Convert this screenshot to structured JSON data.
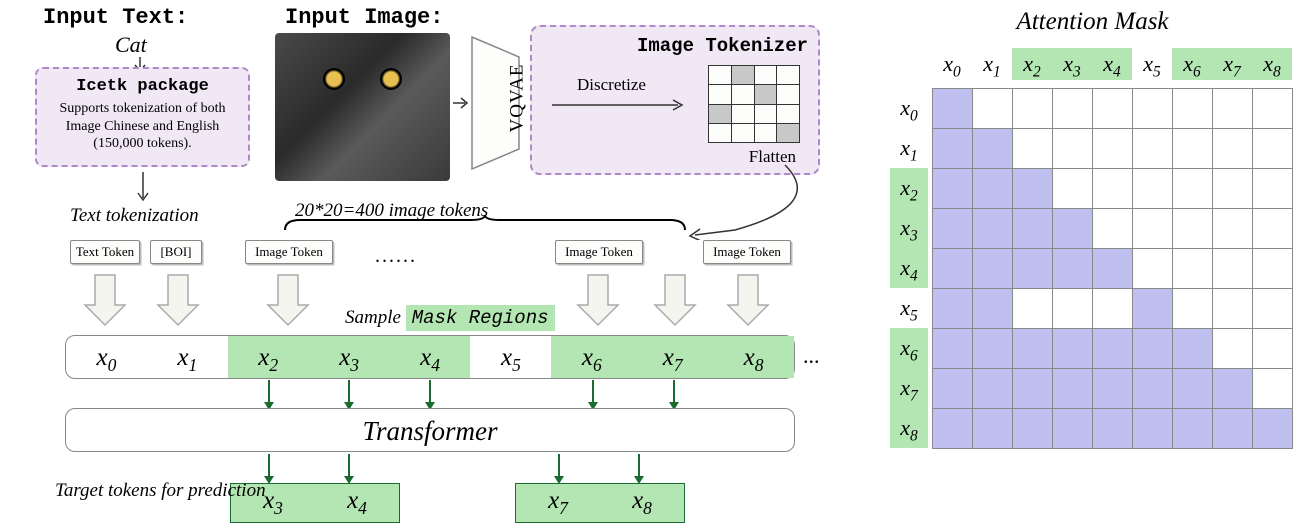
{
  "labels": {
    "input_text": "Input Text:",
    "cat": "Cat",
    "input_image": "Input Image:",
    "icetk_title": "Icetk package",
    "icetk_desc": "Supports tokenization of both Image Chinese and English (150,000 tokens).",
    "vqvae": "VQVAE",
    "tokenizer_title": "Image Tokenizer",
    "discretize": "Discretize",
    "flatten": "Flatten",
    "text_tokenization": "Text tokenization",
    "tokens_count": "20*20=400 image tokens",
    "text_token": "Text Token",
    "boi": "[BOI]",
    "image_token": "Image Token",
    "dots": "......",
    "sample": "Sample",
    "mask_regions": "Mask Regions",
    "transformer": "Transformer",
    "target": "Target tokens for prediction",
    "attn_title": "Attention Mask",
    "strip_dots": "..."
  },
  "tokens": [
    "x₀",
    "x₁",
    "x₂",
    "x₃",
    "x₄",
    "x₅",
    "x₆",
    "x₇",
    "x₈"
  ],
  "masked_tokens": [
    2,
    3,
    4,
    6,
    7,
    8
  ],
  "output_tokens_1": [
    "x₃",
    "x₄"
  ],
  "output_tokens_2": [
    "x₇",
    "x₈"
  ],
  "attention_mask": {
    "masked_cols": [
      2,
      3,
      4,
      6,
      7,
      8
    ],
    "masked_rows": [
      2,
      3,
      4,
      6,
      7,
      8
    ],
    "grid": [
      [
        1,
        0,
        0,
        0,
        0,
        0,
        0,
        0,
        0
      ],
      [
        1,
        1,
        0,
        0,
        0,
        0,
        0,
        0,
        0
      ],
      [
        1,
        1,
        1,
        0,
        0,
        0,
        0,
        0,
        0
      ],
      [
        1,
        1,
        1,
        1,
        0,
        0,
        0,
        0,
        0
      ],
      [
        1,
        1,
        1,
        1,
        1,
        0,
        0,
        0,
        0
      ],
      [
        1,
        1,
        0,
        0,
        0,
        1,
        0,
        0,
        0
      ],
      [
        1,
        1,
        1,
        1,
        1,
        1,
        1,
        0,
        0
      ],
      [
        1,
        1,
        1,
        1,
        1,
        1,
        1,
        1,
        0
      ],
      [
        1,
        1,
        1,
        1,
        1,
        1,
        1,
        1,
        1
      ]
    ]
  },
  "tokenizer_grid_shaded": [
    [
      0,
      1
    ],
    [
      1,
      2
    ],
    [
      2,
      0
    ],
    [
      3,
      3
    ]
  ],
  "chart_data": {
    "type": "diagram",
    "title": "Transformer architecture with text+image tokens and attention mask",
    "tokens": [
      "x0",
      "x1",
      "x2",
      "x3",
      "x4",
      "x5",
      "x6",
      "x7",
      "x8"
    ],
    "mask_regions": [
      [
        2,
        4
      ],
      [
        6,
        8
      ]
    ],
    "target_tokens": [
      "x3",
      "x4",
      "x7",
      "x8"
    ],
    "image_token_count": 400,
    "image_grid": "20x20",
    "text_vocab_size": 150000,
    "attention_mask_matrix": [
      [
        1,
        0,
        0,
        0,
        0,
        0,
        0,
        0,
        0
      ],
      [
        1,
        1,
        0,
        0,
        0,
        0,
        0,
        0,
        0
      ],
      [
        1,
        1,
        1,
        0,
        0,
        0,
        0,
        0,
        0
      ],
      [
        1,
        1,
        1,
        1,
        0,
        0,
        0,
        0,
        0
      ],
      [
        1,
        1,
        1,
        1,
        1,
        0,
        0,
        0,
        0
      ],
      [
        1,
        1,
        0,
        0,
        0,
        1,
        0,
        0,
        0
      ],
      [
        1,
        1,
        1,
        1,
        1,
        1,
        1,
        0,
        0
      ],
      [
        1,
        1,
        1,
        1,
        1,
        1,
        1,
        1,
        0
      ],
      [
        1,
        1,
        1,
        1,
        1,
        1,
        1,
        1,
        1
      ]
    ]
  }
}
